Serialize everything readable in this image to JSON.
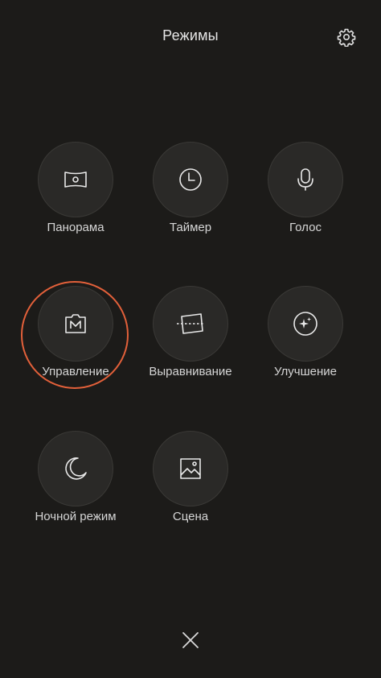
{
  "header": {
    "title": "Режимы",
    "settings_icon": "gear-icon"
  },
  "modes": [
    {
      "id": "panorama",
      "label": "Панорама",
      "icon": "panorama-icon"
    },
    {
      "id": "timer",
      "label": "Таймер",
      "icon": "clock-icon"
    },
    {
      "id": "voice",
      "label": "Голос",
      "icon": "microphone-icon"
    },
    {
      "id": "manual",
      "label": "Управление",
      "icon": "manual-camera-icon",
      "highlighted": true
    },
    {
      "id": "straighten",
      "label": "Выравнивание",
      "icon": "straighten-icon"
    },
    {
      "id": "beautify",
      "label": "Улучшение",
      "icon": "sparkle-icon"
    },
    {
      "id": "night",
      "label": "Ночной режим",
      "icon": "moon-icon"
    },
    {
      "id": "scene",
      "label": "Сцена",
      "icon": "scene-image-icon"
    }
  ],
  "footer": {
    "close_icon": "close-icon"
  },
  "colors": {
    "background": "#1c1b19",
    "button": "#2a2927",
    "highlight": "#e2603a",
    "icon": "#e8e8e8"
  }
}
